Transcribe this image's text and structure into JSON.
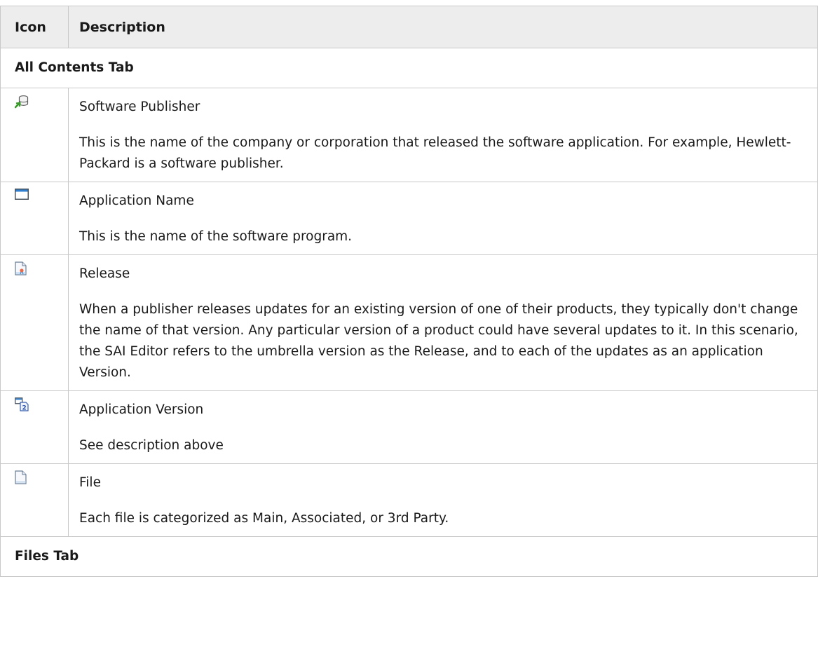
{
  "table": {
    "header": {
      "icon": "Icon",
      "description": "Description"
    },
    "sections": {
      "all_contents": "All Contents Tab",
      "files": "Files Tab"
    },
    "rows": [
      {
        "icon": "software-publisher-icon",
        "title": "Software Publisher",
        "description": "This is the name of the company or corporation that released the software application. For example, Hewlett-Packard is a software publisher."
      },
      {
        "icon": "application-window-icon",
        "title": "Application Name",
        "description": "This is the name of the software program."
      },
      {
        "icon": "release-document-icon",
        "title": "Release",
        "description": "When a publisher releases updates for an existing version of one of their products, they typically don't change the name of that version. Any particular version of a product could have several updates to it. In this scenario, the SAI Editor refers to the umbrella version as the Release, and to each of the updates as an application Version."
      },
      {
        "icon": "application-version-icon",
        "title": "Application Version",
        "description": "See description above"
      },
      {
        "icon": "file-icon",
        "title": "File",
        "description": "Each file is categorized as Main, Associated, or 3rd Party."
      }
    ]
  }
}
